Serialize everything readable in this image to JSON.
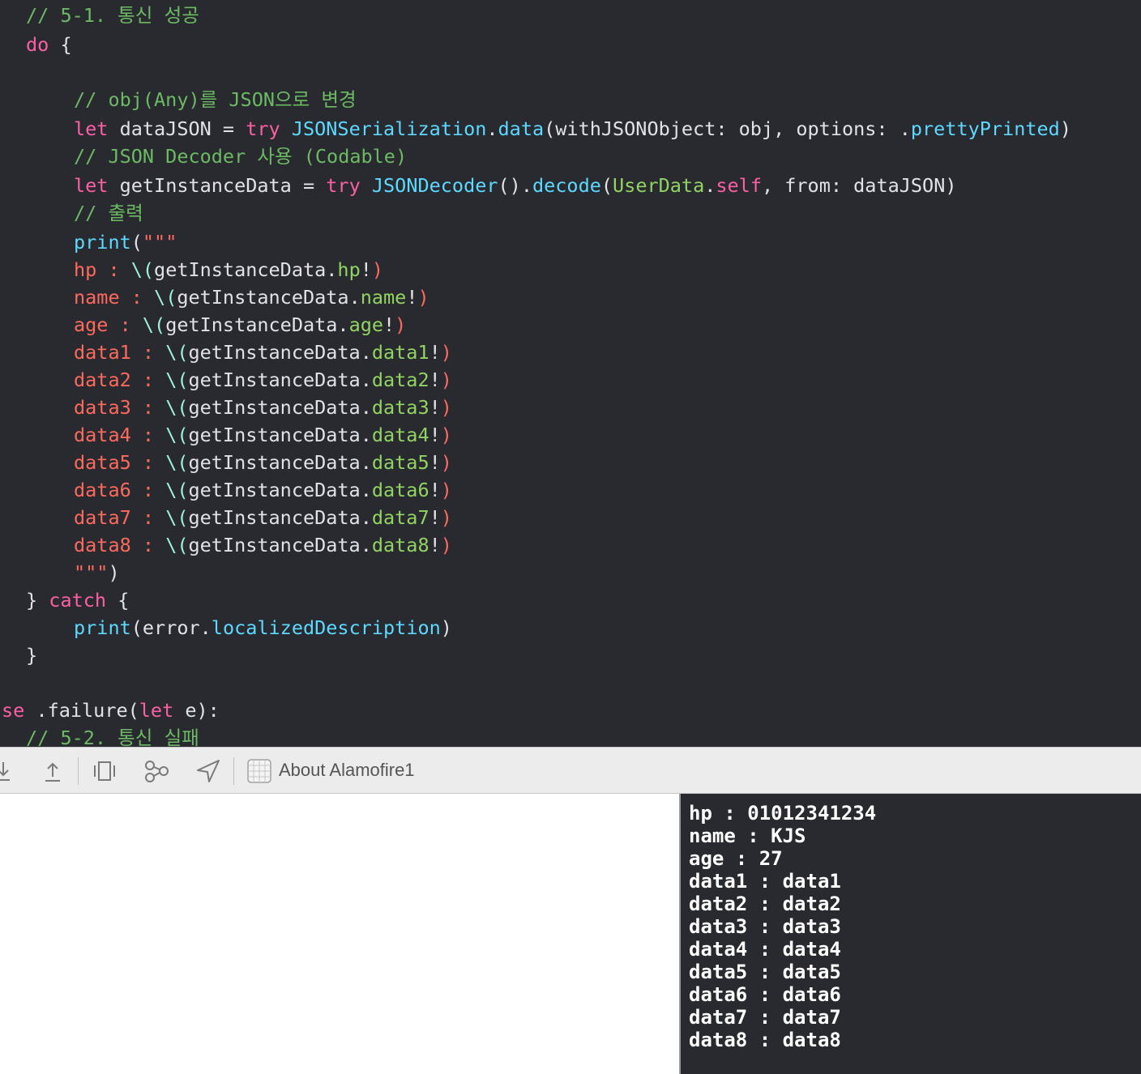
{
  "editor": {
    "c1": "// 5-1. 통신 성공",
    "l2_do": "do",
    "l2_brace": " {",
    "c3": "// obj(Any)를 JSON으로 변경",
    "l4_let": "let",
    "l4_name": " dataJSON = ",
    "l4_try": "try",
    "l4_sp": " ",
    "l4_type": "JSONSerialization",
    "l4_dot": ".",
    "l4_func": "data",
    "l4_args": "(withJSONObject: obj, options: .",
    "l4_opt": "prettyPrinted",
    "l4_close": ")",
    "c5": "// JSON Decoder 사용 (Codable)",
    "l6_let": "let",
    "l6_name": " getInstanceData = ",
    "l6_try": "try",
    "l6_sp": " ",
    "l6_type": "JSONDecoder",
    "l6_paren": "().",
    "l6_func": "decode",
    "l6_open": "(",
    "l6_cls": "UserData",
    "l6_dot": ".",
    "l6_self": "self",
    "l6_rest": ", from: dataJSON)",
    "c7": "// 출력",
    "l8_print": "print",
    "l8_open": "(",
    "l8_quote": "\"\"\"",
    "interp": [
      {
        "key": "hp : ",
        "open": "\\(",
        "obj": "getInstanceData.",
        "prop": "hp",
        "bang": "!",
        "close": ")"
      },
      {
        "key": "name : ",
        "open": "\\(",
        "obj": "getInstanceData.",
        "prop": "name",
        "bang": "!",
        "close": ")"
      },
      {
        "key": "age : ",
        "open": "\\(",
        "obj": "getInstanceData.",
        "prop": "age",
        "bang": "!",
        "close": ")"
      },
      {
        "key": "data1 : ",
        "open": "\\(",
        "obj": "getInstanceData.",
        "prop": "data1",
        "bang": "!",
        "close": ")"
      },
      {
        "key": "data2 : ",
        "open": "\\(",
        "obj": "getInstanceData.",
        "prop": "data2",
        "bang": "!",
        "close": ")"
      },
      {
        "key": "data3 : ",
        "open": "\\(",
        "obj": "getInstanceData.",
        "prop": "data3",
        "bang": "!",
        "close": ")"
      },
      {
        "key": "data4 : ",
        "open": "\\(",
        "obj": "getInstanceData.",
        "prop": "data4",
        "bang": "!",
        "close": ")"
      },
      {
        "key": "data5 : ",
        "open": "\\(",
        "obj": "getInstanceData.",
        "prop": "data5",
        "bang": "!",
        "close": ")"
      },
      {
        "key": "data6 : ",
        "open": "\\(",
        "obj": "getInstanceData.",
        "prop": "data6",
        "bang": "!",
        "close": ")"
      },
      {
        "key": "data7 : ",
        "open": "\\(",
        "obj": "getInstanceData.",
        "prop": "data7",
        "bang": "!",
        "close": ")"
      },
      {
        "key": "data8 : ",
        "open": "\\(",
        "obj": "getInstanceData.",
        "prop": "data8",
        "bang": "!",
        "close": ")"
      }
    ],
    "l20_quote": "\"\"\"",
    "l20_close": ")",
    "l21_brace": "} ",
    "l21_catch": "catch",
    "l21_open": " {",
    "l22_print": "print",
    "l22_open": "(error.",
    "l22_prop": "localizedDescription",
    "l22_close": ")",
    "l23_brace": "}",
    "l24_se": "se",
    "l24_fail": " .failure(",
    "l24_let": "let",
    "l24_rest": " e):",
    "c25": "// 5-2. 통신 실패"
  },
  "toolbar": {
    "icons": [
      "step-into-icon",
      "step-out-icon",
      "view-hierarchy-icon",
      "memory-graph-icon",
      "location-icon",
      "scheme-icon"
    ],
    "scheme_label": "About Alamofire1"
  },
  "console": {
    "lines": [
      "hp : 01012341234",
      "name : KJS",
      "age : 27",
      "data1 : data1",
      "data2 : data2",
      "data3 : data3",
      "data4 : data4",
      "data5 : data5",
      "data6 : data6",
      "data7 : data7",
      "data8 : data8"
    ]
  },
  "colors": {
    "editor_bg": "#292a30",
    "keyword": "#fc5fa3",
    "comment": "#6bba63",
    "type": "#5dd8ff",
    "string": "#fc6a5d",
    "property": "#91d462",
    "console_text": "#ffffff"
  }
}
